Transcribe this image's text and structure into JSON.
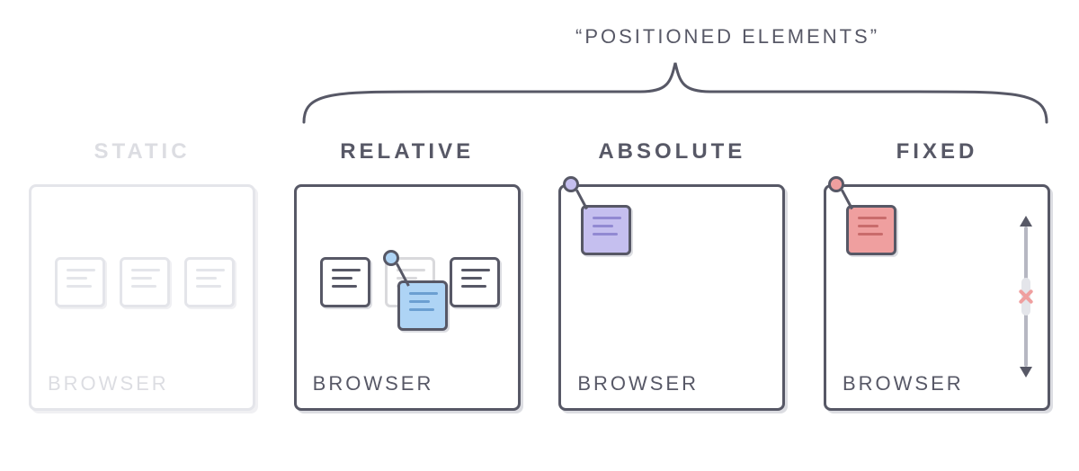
{
  "header": {
    "label": "“POSITIONED ELEMENTS”"
  },
  "panels": {
    "static": {
      "title": "STATIC",
      "label": "BROWSER"
    },
    "relative": {
      "title": "RELATIVE",
      "label": "BROWSER"
    },
    "absolute": {
      "title": "ABSOLUTE",
      "label": "BROWSER"
    },
    "fixed": {
      "title": "FIXED",
      "label": "BROWSER"
    }
  },
  "related_to": [
    "relative",
    "absolute",
    "fixed"
  ]
}
